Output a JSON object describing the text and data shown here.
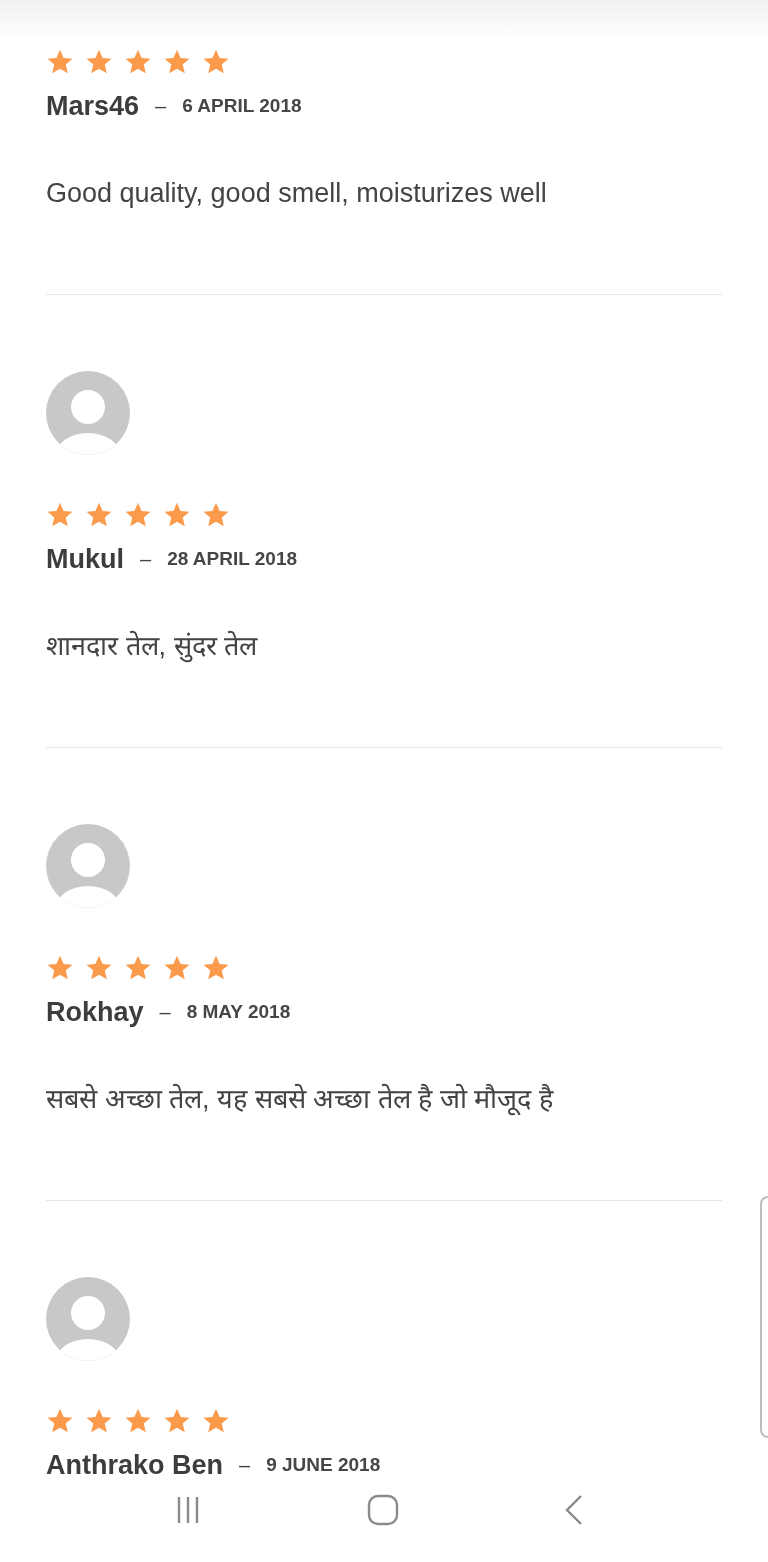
{
  "reviews": [
    {
      "avatar": false,
      "stars": 5,
      "name": "Mars46",
      "separator": "–",
      "date": "6 APRIL 2018",
      "text": "Good quality, good smell, moisturizes well"
    },
    {
      "avatar": true,
      "stars": 5,
      "name": "Mukul",
      "separator": "–",
      "date": "28 APRIL 2018",
      "text": "शानदार तेल, सुंदर तेल"
    },
    {
      "avatar": true,
      "stars": 5,
      "name": "Rokhay",
      "separator": "–",
      "date": "8 MAY 2018",
      "text": "सबसे अच्छा तेल, यह सबसे अच्छा तेल है जो मौजूद है"
    },
    {
      "avatar": true,
      "stars": 5,
      "name": "Anthrako Ben",
      "separator": "–",
      "date": "9 JUNE 2018"
    }
  ]
}
